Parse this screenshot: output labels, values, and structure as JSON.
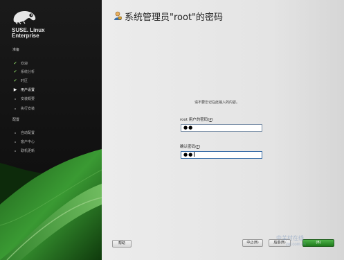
{
  "sidebar": {
    "brand_line1": "SUSE. Linux",
    "brand_line2": "Enterprise",
    "sections": [
      {
        "label": "准备",
        "items": [
          {
            "label": "欢迎",
            "state": "done"
          },
          {
            "label": "系统分析",
            "state": "done"
          },
          {
            "label": "时区",
            "state": "done"
          },
          {
            "label": "用户设置",
            "state": "current"
          },
          {
            "label": "安装概要",
            "state": "pending"
          },
          {
            "label": "执行安装",
            "state": "pending"
          }
        ]
      },
      {
        "label": "配置",
        "items": [
          {
            "label": "自动配置",
            "state": "pending"
          },
          {
            "label": "客户中心",
            "state": "pending"
          },
          {
            "label": "联机更新",
            "state": "pending"
          }
        ]
      }
    ]
  },
  "main": {
    "title": "系统管理员\"root\"的密码",
    "hint": "请不要忘记在此输入的内容。",
    "password_label": "root 用户的密码(",
    "password_key": "P",
    "password_label_end": ")",
    "password_value": "●●",
    "confirm_label": "确认密码(",
    "confirm_key": "F",
    "confirm_label_end": ")",
    "confirm_value": "●●"
  },
  "buttons": {
    "help": "帮助",
    "abort": "中止(B)",
    "back": "后退(B)",
    "next": "(B)"
  },
  "watermark": {
    "line1": "中关村在线",
    "line2": "zol.com.cn"
  },
  "colors": {
    "sidebar_bg": "#111111",
    "accent_green": "#2f8f2a",
    "check_green": "#7ab85a"
  }
}
